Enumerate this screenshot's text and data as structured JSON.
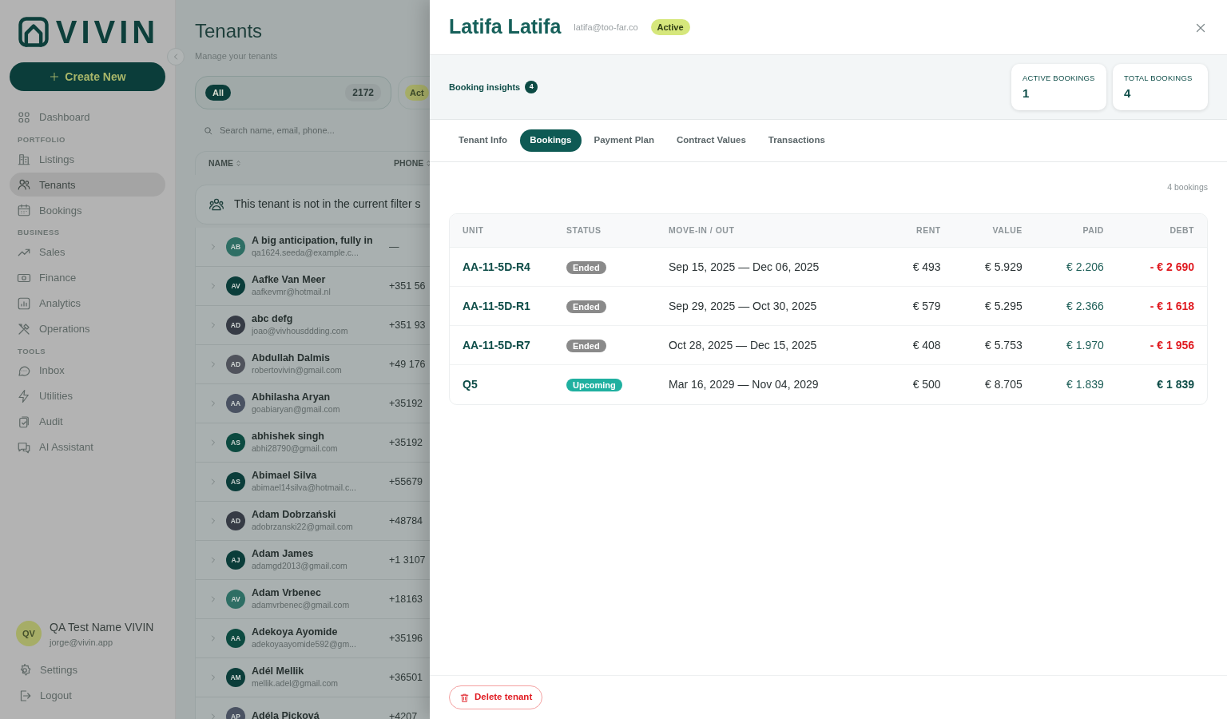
{
  "sidebar": {
    "logo": "VIVIN",
    "create_button": "Create New",
    "nav": [
      {
        "kind": "item",
        "label": "Dashboard",
        "selected": false
      },
      {
        "kind": "section",
        "label": "PORTFOLIO"
      },
      {
        "kind": "item",
        "label": "Listings",
        "selected": false
      },
      {
        "kind": "item",
        "label": "Tenants",
        "selected": true
      },
      {
        "kind": "item",
        "label": "Bookings",
        "selected": false
      },
      {
        "kind": "section",
        "label": "BUSINESS"
      },
      {
        "kind": "item",
        "label": "Sales",
        "selected": false
      },
      {
        "kind": "item",
        "label": "Finance",
        "selected": false
      },
      {
        "kind": "item",
        "label": "Analytics",
        "selected": false
      },
      {
        "kind": "item",
        "label": "Operations",
        "selected": false
      },
      {
        "kind": "section",
        "label": "TOOLS"
      },
      {
        "kind": "item",
        "label": "Inbox",
        "selected": false
      },
      {
        "kind": "item",
        "label": "Utilities",
        "selected": false
      },
      {
        "kind": "item",
        "label": "Audit",
        "selected": false
      },
      {
        "kind": "item",
        "label": "AI Assistant",
        "selected": false
      }
    ],
    "user": {
      "initials": "QV",
      "name": "QA Test Name VIVIN",
      "email": "jorge@vivin.app"
    },
    "footer_links": [
      "Settings",
      "Logout"
    ]
  },
  "page": {
    "title": "Tenants",
    "subtitle": "Manage your tenants",
    "filters": [
      {
        "label": "All",
        "count": "2172",
        "selected": true
      },
      {
        "label": "Act",
        "selected": false
      }
    ],
    "search": {
      "placeholder": "Search name, email, phone..."
    },
    "columns": [
      "NAME",
      "PHONE"
    ],
    "notice": "This tenant is not in the current filter s",
    "tenants": [
      {
        "initials": "AB",
        "color": "#2e6e64",
        "name": "A big anticipation, fully in",
        "email": "qa1624.seeda@example.c...",
        "phone": "—"
      },
      {
        "initials": "AV",
        "color": "#0b3d3a",
        "name": "Aafke Van Meer",
        "email": "aafkevmr@hotmail.nl",
        "phone": "+351 56"
      },
      {
        "initials": "AD",
        "color": "#363b45",
        "name": "abc defg",
        "email": "joao@vivhousddding.com",
        "phone": "+351 93"
      },
      {
        "initials": "AD",
        "color": "#50535c",
        "name": "Abdullah Dalmis",
        "email": "robertovivin@gmail.com",
        "phone": "+49 176"
      },
      {
        "initials": "AA",
        "color": "#4a5262",
        "name": "Abhilasha Aryan",
        "email": "goabiaryan@gmail.com",
        "phone": "+35192"
      },
      {
        "initials": "AS",
        "color": "#0c4a40",
        "name": "abhishek singh",
        "email": "abhi28790@gmail.com",
        "phone": "+35192"
      },
      {
        "initials": "AS",
        "color": "#0b3d3a",
        "name": "Abimael Silva",
        "email": "abimael14silva@hotmail.c...",
        "phone": "+55679"
      },
      {
        "initials": "AD",
        "color": "#363b45",
        "name": "Adam Dobrzański",
        "email": "adobrzanski22@gmail.com",
        "phone": "+48784"
      },
      {
        "initials": "AJ",
        "color": "#0b3d3a",
        "name": "Adam James",
        "email": "adamgd2013@gmail.com",
        "phone": "+1 3107"
      },
      {
        "initials": "AV",
        "color": "#2e6e64",
        "name": "Adam Vrbenec",
        "email": "adamvrbenec@gmail.com",
        "phone": "+18163"
      },
      {
        "initials": "AA",
        "color": "#0c4a40",
        "name": "Adekoya Ayomide",
        "email": "adekoyaayomide592@gm...",
        "phone": "+35196"
      },
      {
        "initials": "AM",
        "color": "#0b3d3a",
        "name": "Adél Mellik",
        "email": "mellik.adel@gmail.com",
        "phone": "+36501"
      },
      {
        "initials": "AP",
        "color": "#4a5262",
        "name": "Adéla Picková",
        "phone": "+4207"
      }
    ]
  },
  "drawer": {
    "name": "Latifa Latifa",
    "email": "latifa@too-far.co",
    "status": "Active",
    "insights": {
      "label": "Booking insights",
      "count": "4"
    },
    "stats": [
      {
        "label": "ACTIVE BOOKINGS",
        "value": "1"
      },
      {
        "label": "TOTAL BOOKINGS",
        "value": "4"
      }
    ],
    "tabs": [
      {
        "label": "Tenant Info",
        "selected": false
      },
      {
        "label": "Bookings",
        "selected": true
      },
      {
        "label": "Payment Plan",
        "selected": false
      },
      {
        "label": "Contract Values",
        "selected": false
      },
      {
        "label": "Transactions",
        "selected": false
      }
    ],
    "bookings_count": "4 bookings",
    "table": {
      "columns": [
        "UNIT",
        "STATUS",
        "MOVE-IN / OUT",
        "RENT",
        "VALUE",
        "PAID",
        "DEBT"
      ],
      "rows": [
        {
          "unit": "AA-11-5D-R4",
          "kind": "ended",
          "status": "Ended",
          "dates": "Sep 15, 2025 — Dec 06, 2025",
          "rent": "€ 493",
          "value": "€ 5.929",
          "paid": "€ 2.206",
          "debt": "- € 2 690",
          "debt_negative": true
        },
        {
          "unit": "AA-11-5D-R1",
          "kind": "ended",
          "status": "Ended",
          "dates": "Sep 29, 2025 — Oct 30, 2025",
          "rent": "€ 579",
          "value": "€ 5.295",
          "paid": "€ 2.366",
          "debt": "- € 1 618",
          "debt_negative": true
        },
        {
          "unit": "AA-11-5D-R7",
          "kind": "ended",
          "status": "Ended",
          "dates": "Oct 28, 2025 — Dec 15, 2025",
          "rent": "€ 408",
          "value": "€ 5.753",
          "paid": "€ 1.970",
          "debt": "- € 1 956",
          "debt_negative": true
        },
        {
          "unit": "Q5",
          "kind": "upcoming",
          "status": "Upcoming",
          "dates": "Mar 16, 2029 — Nov 04, 2029",
          "rent": "€ 500",
          "value": "€ 8.705",
          "paid": "€ 1.839",
          "debt": "€ 1 839",
          "debt_negative": false
        }
      ]
    },
    "delete_button": "Delete tenant"
  }
}
